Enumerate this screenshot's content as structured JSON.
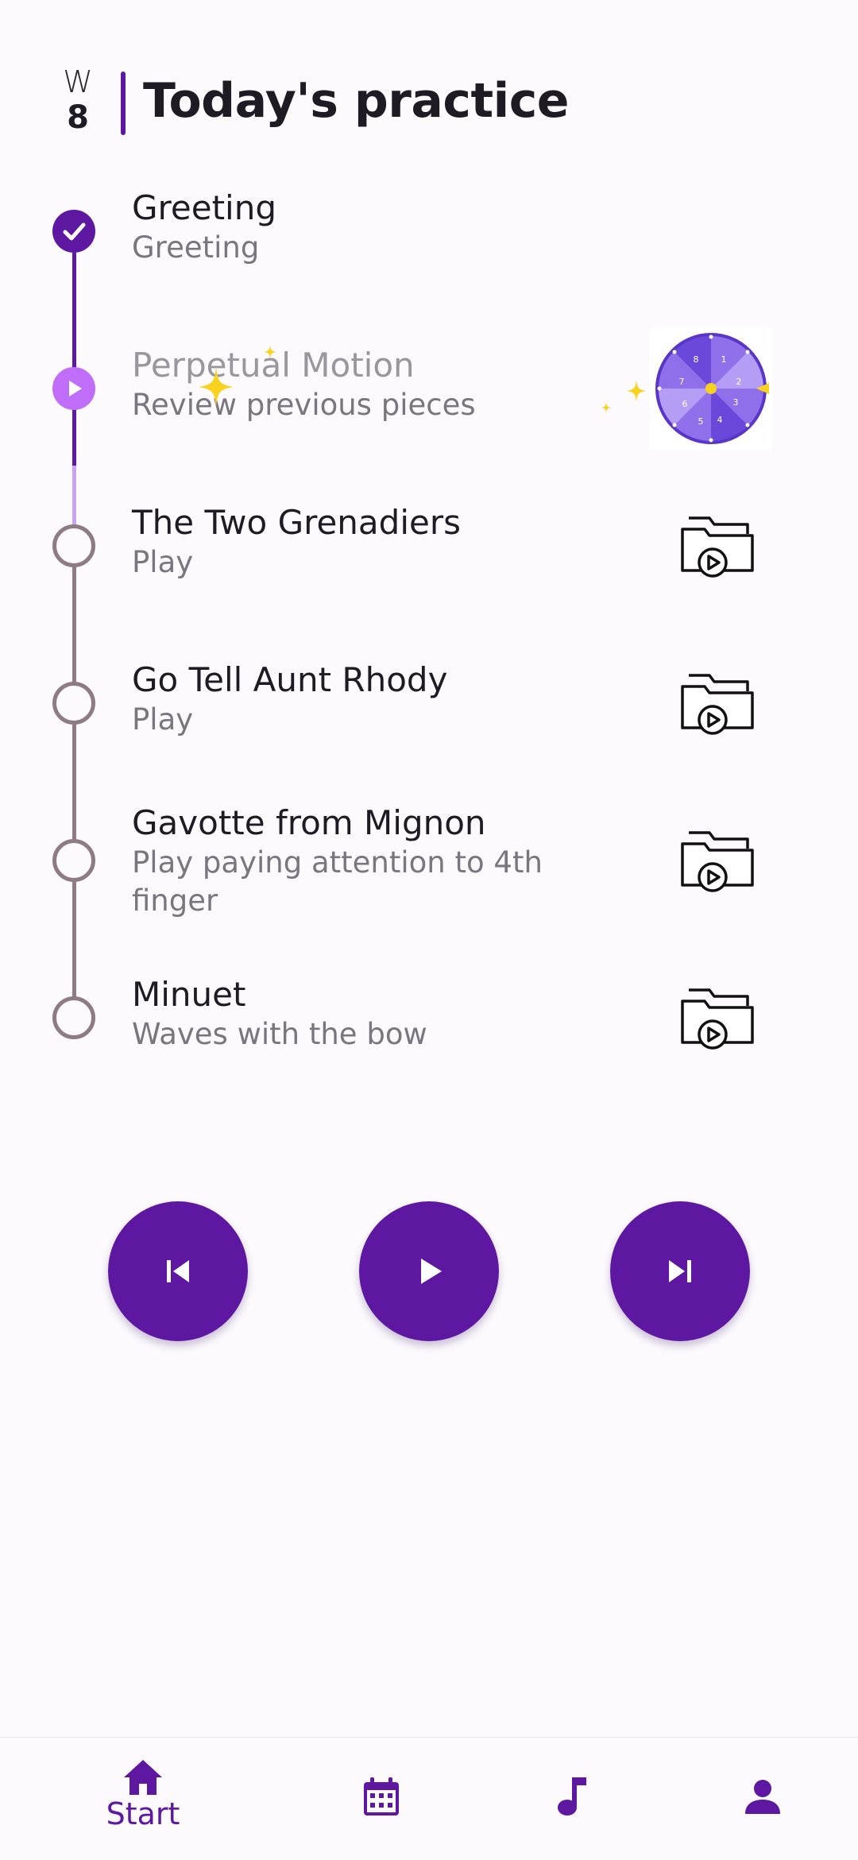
{
  "header": {
    "week_letter": "W",
    "week_number": "8",
    "title": "Today's practice"
  },
  "items": [
    {
      "name": "Greeting",
      "sub": "Greeting",
      "status": "done"
    },
    {
      "name": "Perpetual Motion",
      "sub": "Review previous pieces",
      "status": "current",
      "icon": "spin-wheel-icon"
    },
    {
      "name": "The Two Grenadiers",
      "sub": "Play",
      "status": "todo",
      "icon": "video-folder-icon"
    },
    {
      "name": "Go Tell Aunt Rhody",
      "sub": "Play",
      "status": "todo",
      "icon": "video-folder-icon"
    },
    {
      "name": "Gavotte from Mignon",
      "sub": "Play paying attention to 4th finger",
      "status": "todo",
      "icon": "video-folder-icon"
    },
    {
      "name": "Minuet",
      "sub": "Waves with the bow",
      "status": "todo",
      "icon": "video-folder-icon"
    }
  ],
  "wheel_numbers": [
    "1",
    "2",
    "3",
    "4",
    "5",
    "6",
    "7",
    "8"
  ],
  "controls": {
    "previous": "skip-previous-icon",
    "play": "play-icon",
    "next": "skip-next-icon"
  },
  "nav": [
    {
      "label": "Start",
      "icon": "home-icon",
      "active": true
    },
    {
      "label": "",
      "icon": "calendar-icon",
      "active": false
    },
    {
      "label": "",
      "icon": "music-note-icon",
      "active": false
    },
    {
      "label": "",
      "icon": "person-icon",
      "active": false
    }
  ],
  "colors": {
    "primary": "#5e17a1",
    "current_node": "#c06dfa",
    "todo_line": "#8e7b84",
    "sparkle": "#f8d21e"
  }
}
